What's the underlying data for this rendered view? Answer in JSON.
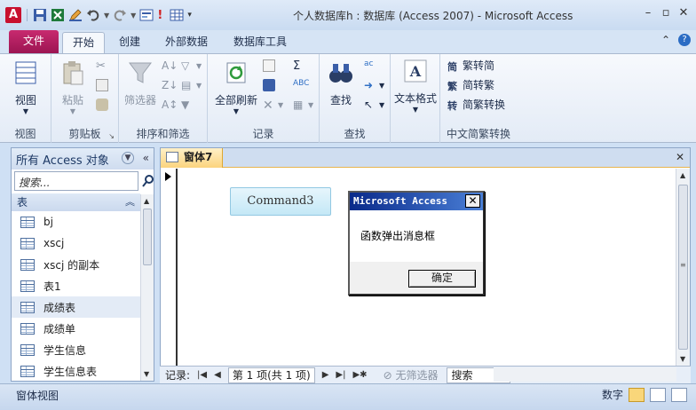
{
  "window": {
    "title": "个人数据库h : 数据库 (Access 2007)  -  Microsoft Access",
    "app_icon_letter": "A"
  },
  "ribbon_tabs": {
    "file": "文件",
    "home": "开始",
    "create": "创建",
    "external": "外部数据",
    "dbtools": "数据库工具"
  },
  "ribbon": {
    "view": {
      "label": "视图",
      "group": "视图"
    },
    "clipboard": {
      "paste": "粘贴",
      "group": "剪贴板"
    },
    "sort_filter": {
      "filter": "筛选器",
      "group": "排序和筛选"
    },
    "records": {
      "refresh": "全部刷新",
      "group": "记录"
    },
    "find": {
      "find": "查找",
      "group": "查找"
    },
    "text_format": {
      "label": "文本格式"
    },
    "chinese": {
      "to_simplified": "繁转简",
      "to_traditional": "简转繁",
      "convert": "简繁转换",
      "group": "中文简繁转换"
    }
  },
  "nav": {
    "header": "所有 Access 对象",
    "search_placeholder": "搜索...",
    "group_label": "表",
    "items": [
      "bj",
      "xscj",
      "xscj 的副本",
      "表1",
      "成绩表",
      "成绩单",
      "学生信息",
      "学生信息表"
    ],
    "selected_index": 4
  },
  "document": {
    "tab_label": "窗体7",
    "command_button": "Command3"
  },
  "msgbox": {
    "title": "Microsoft Access",
    "message": "函数弹出消息框",
    "ok": "确定"
  },
  "record_nav": {
    "label": "记录:",
    "current": "第 1 项(共 1 项)",
    "no_filter": "无筛选器",
    "search": "搜索"
  },
  "status": {
    "view_name": "窗体视图",
    "mode": "数字"
  },
  "colors": {
    "file_tab": "#b01f5f",
    "doc_tab": "#fbd47e",
    "title_gradient_start": "#0a2a8a",
    "command_button": "#c4e8f6"
  }
}
